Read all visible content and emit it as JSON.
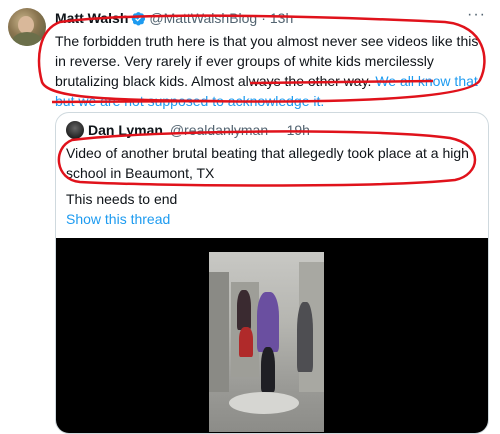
{
  "tweet": {
    "author_name": "Matt Walsh",
    "author_handle": "@MattWalshBlog",
    "separator": "·",
    "time": "13h",
    "more_icon": "more-icon",
    "text_part1": "The forbidden truth here is that you almost never see videos like this in reverse. Very rarely if ever groups of white kids mercilessly brutalizing black kids. Almost always the other way.",
    "text_part2": "We all know that but we are not supposed to acknowledge it."
  },
  "quoted_tweet": {
    "author_name": "Dan Lyman",
    "author_handle": "@realdanlyman",
    "separator": "·",
    "time": "19h",
    "text": "Video of another brutal beating that allegedly took place at a high school in Beaumont, TX",
    "extra_text": "This needs to end",
    "show_thread": "Show this thread"
  },
  "annotation_color": "#e0121b",
  "link_color": "#1d9bf0"
}
